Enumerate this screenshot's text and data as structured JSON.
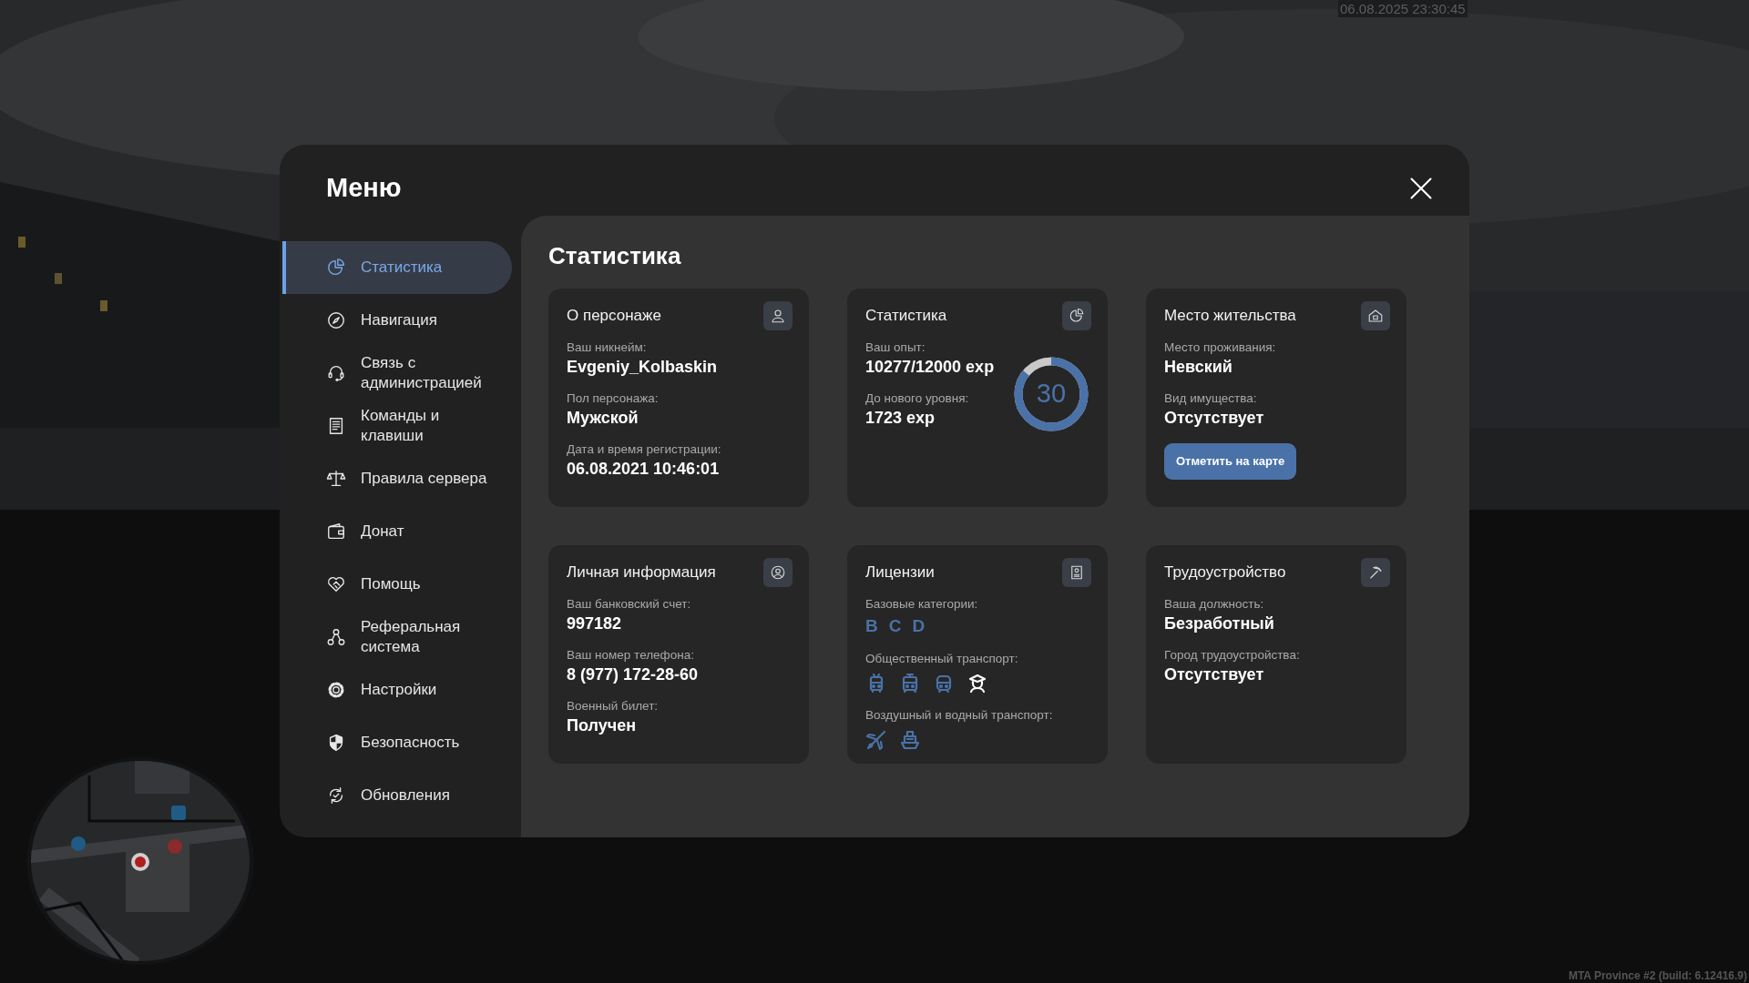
{
  "overlay": {
    "clock": "06.08.2025 23:30:45",
    "build": "MTA Province #2 (build: 6.12416.9)"
  },
  "menu": {
    "title": "Меню",
    "items": [
      {
        "label": "Статистика",
        "selected": true
      },
      {
        "label": "Навигация",
        "selected": false
      },
      {
        "label": "Связь с администрацией",
        "selected": false
      },
      {
        "label": "Команды и клавиши",
        "selected": false
      },
      {
        "label": "Правила сервера",
        "selected": false
      },
      {
        "label": "Донат",
        "selected": false
      },
      {
        "label": "Помощь",
        "selected": false
      },
      {
        "label": "Реферальная система",
        "selected": false
      },
      {
        "label": "Настройки",
        "selected": false
      },
      {
        "label": "Безопасность",
        "selected": false
      },
      {
        "label": "Обновления",
        "selected": false
      }
    ]
  },
  "page": {
    "title": "Статистика",
    "cards": [
      {
        "title": "О персонаже",
        "rows": [
          {
            "kind": "field",
            "label": "Ваш никнейм:",
            "value": "Evgeniy_Kolbaskin"
          },
          {
            "kind": "field",
            "label": "Пол персонажа:",
            "value": "Мужской"
          },
          {
            "kind": "field",
            "label": "Дата и время регистрации:",
            "value": "06.08.2021 10:46:01"
          }
        ]
      },
      {
        "title": "Статистика",
        "rows": [
          {
            "kind": "field",
            "label": "Ваш опыт:",
            "value": "10277/12000 exp"
          },
          {
            "kind": "field",
            "label": "До нового уровня:",
            "value": "1723 exp"
          }
        ],
        "ring": {
          "level": 0.86,
          "text": "30"
        }
      },
      {
        "title": "Место жительства",
        "rows": [
          {
            "kind": "field",
            "label": "Место проживания:",
            "value": "Невский"
          },
          {
            "kind": "field",
            "label": "Вид имущества:",
            "value": "Отсутствует"
          },
          {
            "kind": "button",
            "label": "Отметить на карте"
          }
        ]
      },
      {
        "title": "Личная информация",
        "rows": [
          {
            "kind": "field",
            "label": "Ваш банковский счет:",
            "value": "997182"
          },
          {
            "kind": "field",
            "label": "Ваш номер телефона:",
            "value": "8 (977) 172-28-60"
          },
          {
            "kind": "field",
            "label": "Военный билет:",
            "value": "Получен"
          }
        ]
      },
      {
        "title": "Лицензии",
        "rows": [
          {
            "kind": "letters",
            "label": "Базовые категории:",
            "letters": [
              "B",
              "C",
              "D"
            ]
          },
          {
            "kind": "icons",
            "label": "Общественный транспорт:",
            "icons": [
              {
                "color": "#4a72a8"
              },
              {
                "color": "#4a72a8"
              },
              {
                "color": "#4a72a8"
              },
              {
                "color": "#ffffff"
              }
            ]
          },
          {
            "kind": "icons",
            "label": "Воздушный и водный транспорт:",
            "icons": [
              {
                "color": "#4a72a8"
              },
              {
                "color": "#4a72a8"
              }
            ]
          }
        ]
      },
      {
        "title": "Трудоустройство",
        "rows": [
          {
            "kind": "field",
            "label": "Ваша должность:",
            "value": "Безработный"
          },
          {
            "kind": "field",
            "label": "Город трудоустройства:",
            "value": "Отсутствует"
          }
        ]
      }
    ]
  }
}
